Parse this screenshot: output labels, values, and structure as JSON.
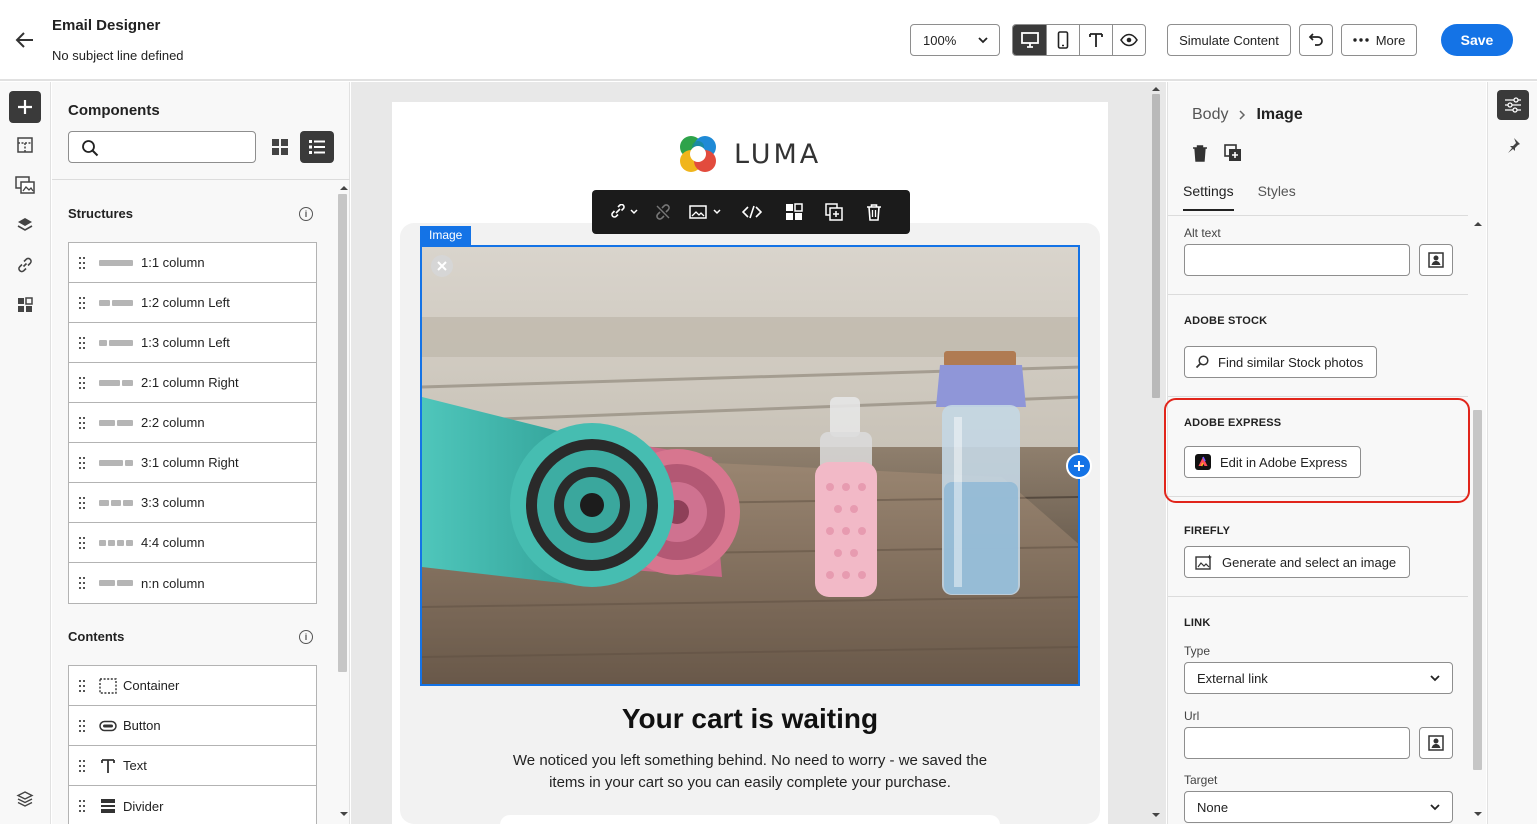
{
  "header": {
    "title": "Email Designer",
    "subtitle": "No subject line defined",
    "zoom": "100%",
    "simulate_label": "Simulate Content",
    "more_label": "More",
    "save_label": "Save"
  },
  "components": {
    "title": "Components",
    "search_placeholder": "",
    "structures_title": "Structures",
    "structures": [
      {
        "label": "1:1 column",
        "cols": [
          1
        ]
      },
      {
        "label": "1:2 column Left",
        "cols": [
          1,
          2
        ]
      },
      {
        "label": "1:3 column Left",
        "cols": [
          1,
          3
        ]
      },
      {
        "label": "2:1 column Right",
        "cols": [
          2,
          1
        ]
      },
      {
        "label": "2:2 column",
        "cols": [
          1,
          1
        ]
      },
      {
        "label": "3:1 column Right",
        "cols": [
          3,
          1
        ]
      },
      {
        "label": "3:3 column",
        "cols": [
          1,
          1,
          1
        ]
      },
      {
        "label": "4:4 column",
        "cols": [
          1,
          1,
          1,
          1
        ]
      },
      {
        "label": "n:n column",
        "cols": [
          1,
          1
        ]
      }
    ],
    "contents_title": "Contents",
    "contents": [
      {
        "label": "Container",
        "icon": "container-icon"
      },
      {
        "label": "Button",
        "icon": "button-icon"
      },
      {
        "label": "Text",
        "icon": "text-icon"
      },
      {
        "label": "Divider",
        "icon": "divider-icon"
      }
    ]
  },
  "canvas": {
    "logo_text": "LUMA",
    "image_tag": "Image",
    "headline": "Your cart is waiting",
    "body": "We noticed you left something behind. No need to worry - we saved the items in your cart so you can easily complete your purchase."
  },
  "properties": {
    "breadcrumb": [
      "Body",
      "Image"
    ],
    "tabs": [
      "Settings",
      "Styles"
    ],
    "alt_text_label": "Alt text",
    "alt_text_value": "",
    "adobe_stock_title": "ADOBE STOCK",
    "adobe_stock_button": "Find similar Stock photos",
    "adobe_express_title": "ADOBE EXPRESS",
    "adobe_express_button": "Edit in Adobe Express",
    "firefly_title": "FIREFLY",
    "firefly_button": "Generate and select an image",
    "link_title": "LINK",
    "type_label": "Type",
    "type_value": "External link",
    "url_label": "Url",
    "url_value": "",
    "target_label": "Target",
    "target_value": "None"
  },
  "colors": {
    "accent": "#1473e6",
    "highlight": "#e1251b",
    "dark_button": "#3a3a3a"
  }
}
